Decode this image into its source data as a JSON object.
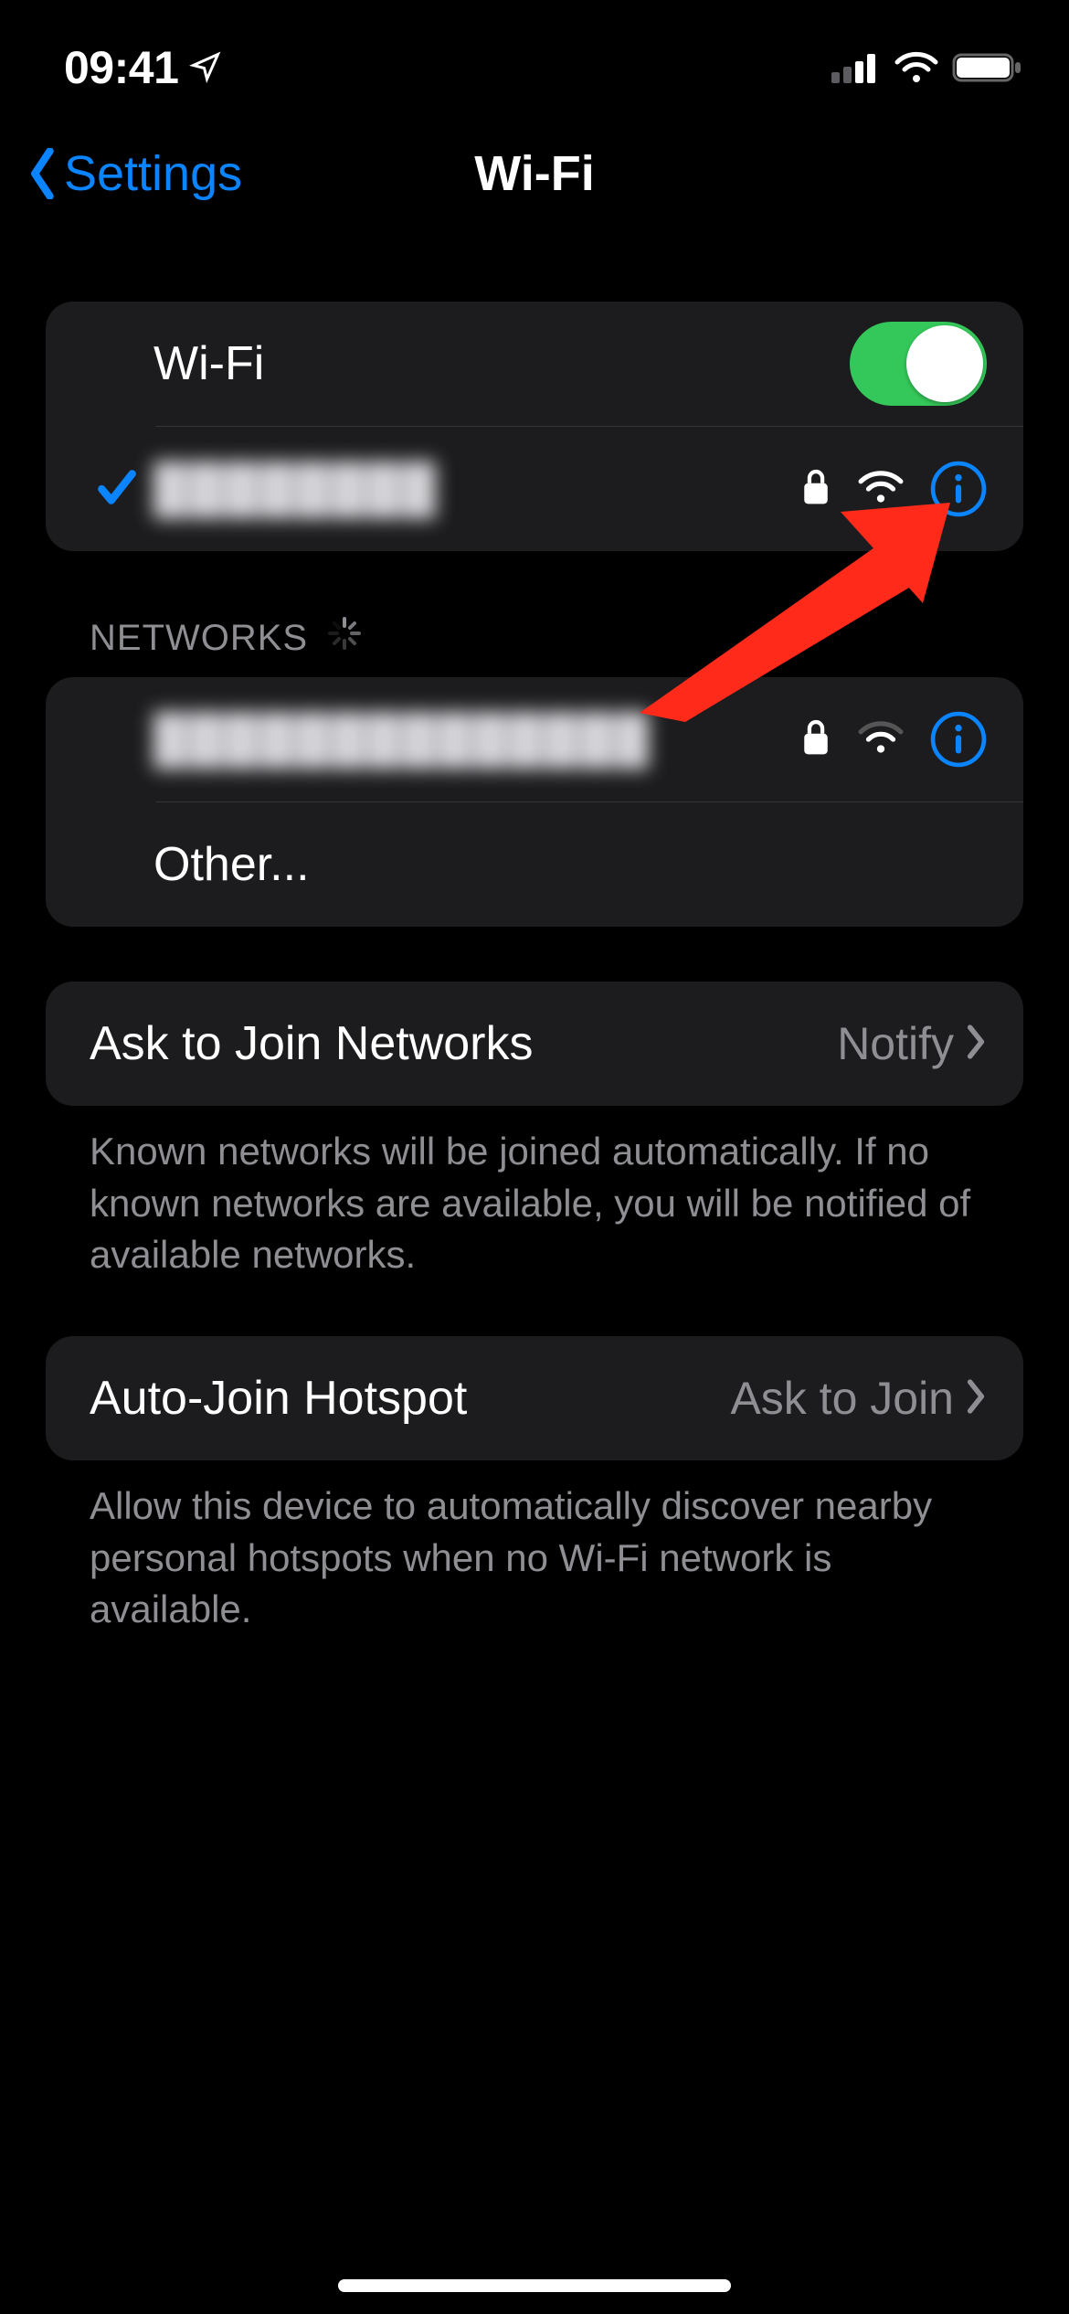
{
  "status": {
    "time": "09:41"
  },
  "nav": {
    "back_label": "Settings",
    "title": "Wi-Fi"
  },
  "wifi": {
    "toggle_label": "Wi-Fi",
    "enabled": true,
    "current_network": {
      "name": "████████",
      "secured": true
    }
  },
  "networks": {
    "header": "NETWORKS",
    "items": [
      {
        "name": "██████████████",
        "secured": true,
        "signal": "weak"
      }
    ],
    "other_label": "Other..."
  },
  "ask_join": {
    "label": "Ask to Join Networks",
    "value": "Notify",
    "footnote": "Known networks will be joined automatically. If no known networks are available, you will be notified of available networks."
  },
  "auto_hotspot": {
    "label": "Auto-Join Hotspot",
    "value": "Ask to Join",
    "footnote": "Allow this device to automatically discover nearby personal hotspots when no Wi-Fi network is available."
  }
}
